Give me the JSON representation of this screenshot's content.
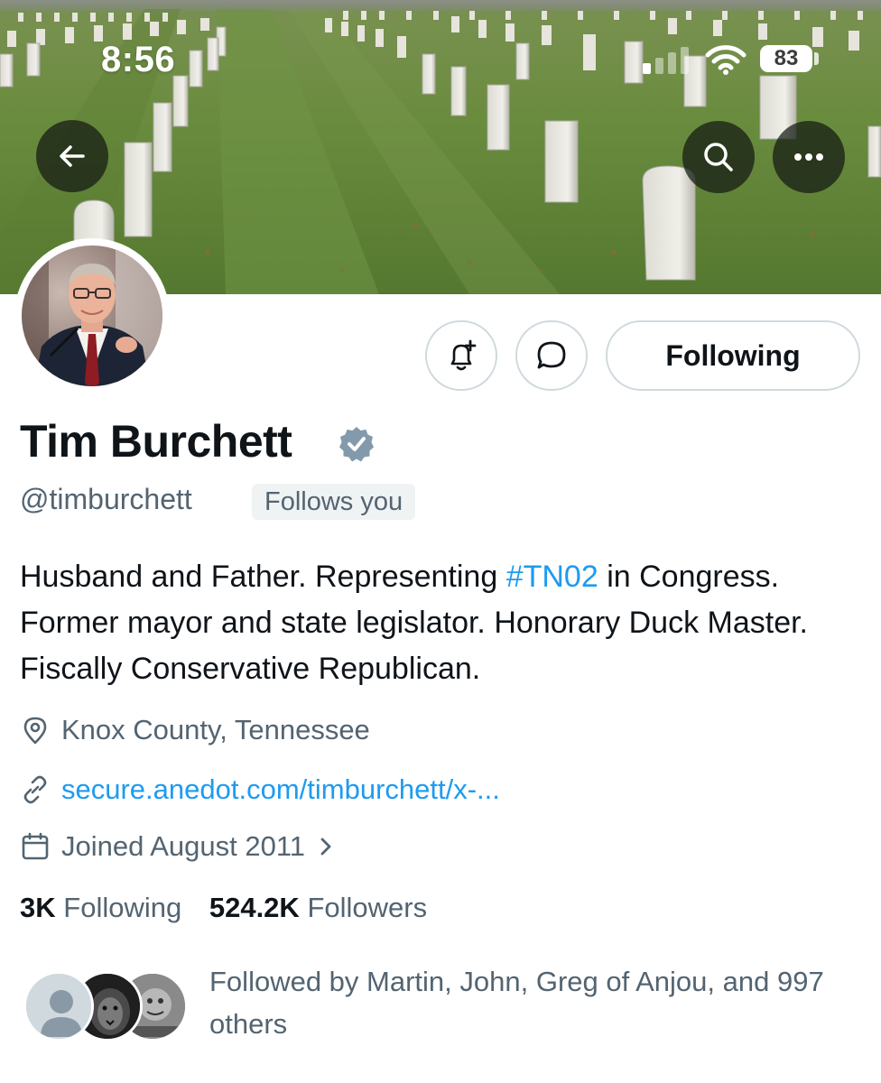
{
  "status_bar": {
    "time": "8:56",
    "battery": "83",
    "signal_bars_active": 1
  },
  "header": {
    "back_icon": "arrow-left-icon",
    "search_icon": "search-icon",
    "more_icon": "more-horizontal-icon"
  },
  "profile": {
    "name": "Tim Burchett",
    "handle": "@timburchett",
    "follows_you": "Follows you",
    "following_button": "Following",
    "bio": {
      "before": "Husband and Father. Representing ",
      "hashtag": "#TN02",
      "after": " in Congress. Former mayor and state legislator. Honorary Duck Master. Fiscally Conservative Republican."
    },
    "location": "Knox County, Tennessee",
    "website": "secure.anedot.com/timburchett/x-...",
    "joined": "Joined August 2011",
    "following_count": "3K",
    "following_label": "Following",
    "followers_count": "524.2K",
    "followers_label": "Followers",
    "followed_by": "Followed by Martin, John, Greg of Anjou, and 997 others"
  },
  "colors": {
    "accent": "#1d9bf0",
    "secondary_text": "#536471",
    "verified": "#829aab"
  }
}
